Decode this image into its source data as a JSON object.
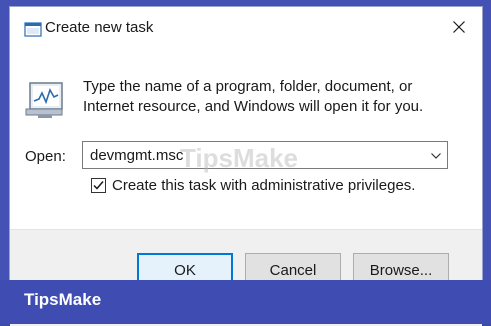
{
  "window": {
    "title": "Create new task",
    "title_icon": "run-dialog-icon",
    "close_icon": "close-icon"
  },
  "content": {
    "icon": "task-manager-icon",
    "description": "Type the name of a program, folder, document, or Internet resource, and Windows will open it for you.",
    "open_label": "Open:",
    "open_value": "devmgmt.msc",
    "dropdown_icon": "chevron-down-icon",
    "admin_checkbox_label": "Create this task with administrative privileges.",
    "admin_checked": true
  },
  "buttons": {
    "ok": "OK",
    "cancel": "Cancel",
    "browse": "Browse..."
  },
  "watermark": {
    "center_text": "TipsMake",
    "brand_text": "TipsMake"
  },
  "colors": {
    "frame": "#4452b6",
    "accent": "#0078d7",
    "footer": "#f0f0f0"
  }
}
